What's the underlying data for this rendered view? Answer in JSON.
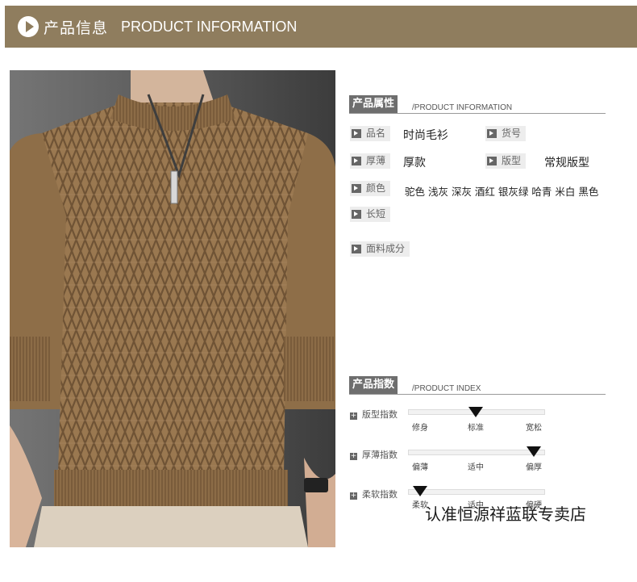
{
  "header": {
    "title_cn": "产品信息",
    "title_en": "PRODUCT INFORMATION"
  },
  "colors": {
    "banner": "#8f7d5e",
    "sweater": "#9a7850",
    "tag": "#6e6e6e"
  },
  "product_info": {
    "tag": "产品属性",
    "tag_en": "/PRODUCT INFORMATION",
    "name_label": "品名",
    "name_value": "时尚毛衫",
    "sku_label": "货号",
    "sku_value": "",
    "thickness_label": "厚薄",
    "thickness_value": "厚款",
    "fit_label": "版型",
    "fit_value": "常规版型",
    "color_label": "颜色",
    "color_value": "驼色 浅灰 深灰 酒红 银灰绿 哈青 米白 黑色",
    "length_label": "长短",
    "length_value": "",
    "fabric_label": "面料成分",
    "fabric_value": ""
  },
  "product_index": {
    "tag": "产品指数",
    "tag_en": "/PRODUCT INDEX",
    "rows": [
      {
        "label": "版型指数",
        "ticks": [
          "修身",
          "标准",
          "宽松"
        ],
        "selected_index": 1
      },
      {
        "label": "厚薄指数",
        "ticks": [
          "偏薄",
          "适中",
          "偏厚"
        ],
        "selected_index": 2
      },
      {
        "label": "柔软指数",
        "ticks": [
          "柔软",
          "适中",
          "偏硬"
        ],
        "selected_index": 0
      }
    ]
  },
  "watermark": "认准恒源祥蓝联专卖店"
}
